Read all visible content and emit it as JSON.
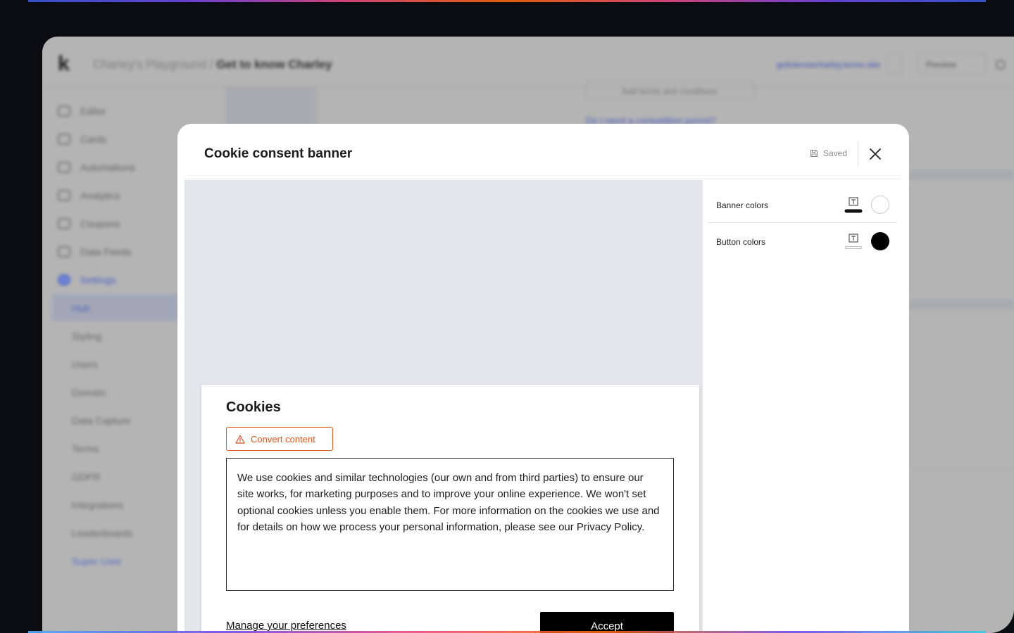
{
  "background_app": {
    "breadcrumb_parent": "Charley's Playground",
    "breadcrumb_separator": "/",
    "breadcrumb_current": "Get to know Charley",
    "url": "gettoknowcharley.komo.site",
    "preview_label": "Preview",
    "sidebar": {
      "items": [
        {
          "label": "Editor"
        },
        {
          "label": "Cards"
        },
        {
          "label": "Automations"
        },
        {
          "label": "Analytics"
        },
        {
          "label": "Coupons"
        },
        {
          "label": "Data Feeds"
        },
        {
          "label": "Settings"
        }
      ],
      "sub_items": [
        {
          "label": "Hub"
        },
        {
          "label": "Styling"
        },
        {
          "label": "Users"
        },
        {
          "label": "Domain"
        },
        {
          "label": "Data Capture"
        },
        {
          "label": "Terms"
        },
        {
          "label": "GDPR"
        },
        {
          "label": "Integrations"
        },
        {
          "label": "Leaderboards"
        },
        {
          "label": "Super User"
        }
      ]
    },
    "add_terms_label": "Add terms and conditions",
    "competition_link": "Do I need a competition permit?"
  },
  "modal": {
    "title": "Cookie consent banner",
    "saved_label": "Saved",
    "close_label": "×"
  },
  "banner": {
    "title": "Cookies",
    "convert_label": "Convert content",
    "body_text": "We use cookies and similar technologies (our own and from third parties) to ensure our site works, for marketing purposes and to improve your online experience. We won't set optional cookies unless you enable them. For more information on the cookies we use and for details on how we process your personal information, please see our Privacy Policy.",
    "manage_label": "Manage your preferences",
    "accept_label": "Accept"
  },
  "settings": {
    "banner_colors_label": "Banner colors",
    "button_colors_label": "Button colors",
    "banner_text_color": "#111111",
    "banner_background_color": "#ffffff",
    "button_text_color": "#ffffff",
    "button_background_color": "#000000"
  },
  "colors": {
    "warning_accent": "#ea5a1c",
    "preview_background": "#e4e7eb",
    "accent_blue": "#4c63c5"
  }
}
